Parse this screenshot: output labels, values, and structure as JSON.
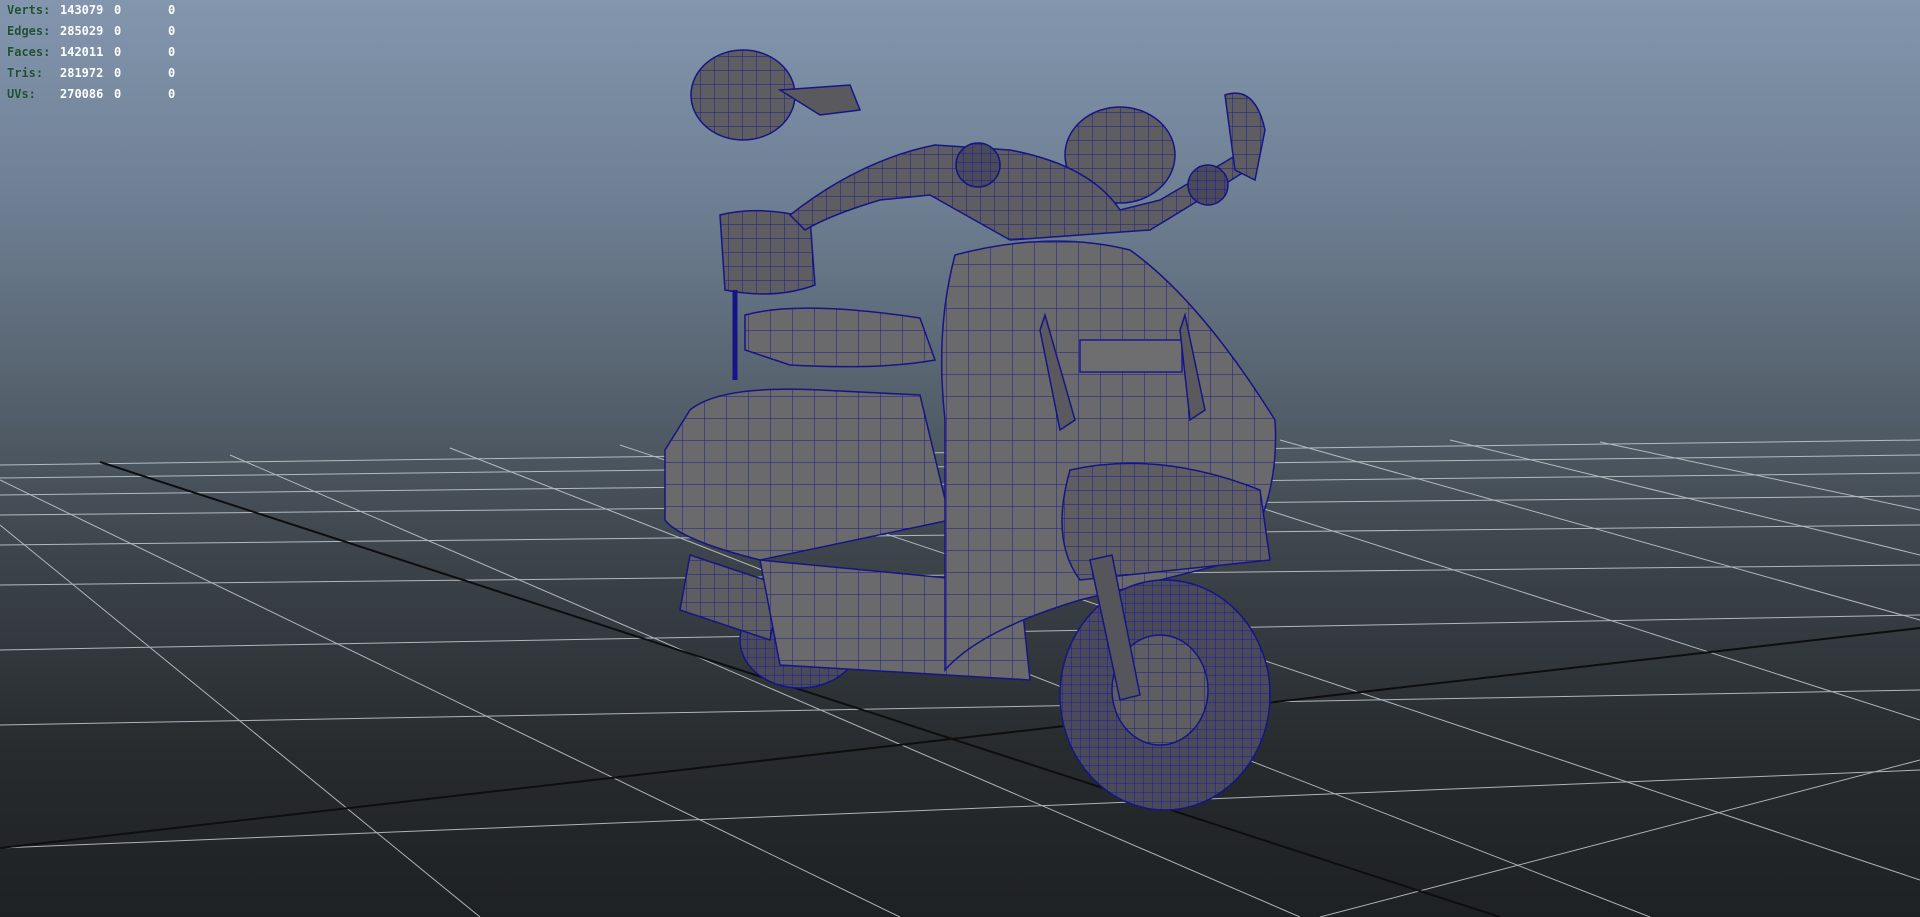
{
  "hud": {
    "rows": [
      {
        "label": "Verts:",
        "value": "143079",
        "selected": "0",
        "uv": "0"
      },
      {
        "label": "Edges:",
        "value": "285029",
        "selected": "0",
        "uv": "0"
      },
      {
        "label": "Faces:",
        "value": "142011",
        "selected": "0",
        "uv": "0"
      },
      {
        "label": "Tris:",
        "value": "281972",
        "selected": "0",
        "uv": "0"
      },
      {
        "label": "UVs:",
        "value": "270086",
        "selected": "0",
        "uv": "0"
      }
    ]
  },
  "colors": {
    "wireframe": "#1a1a9a",
    "body": "#6b6b6d",
    "grid": "#c9ced3",
    "grid_axis": "#111111"
  }
}
